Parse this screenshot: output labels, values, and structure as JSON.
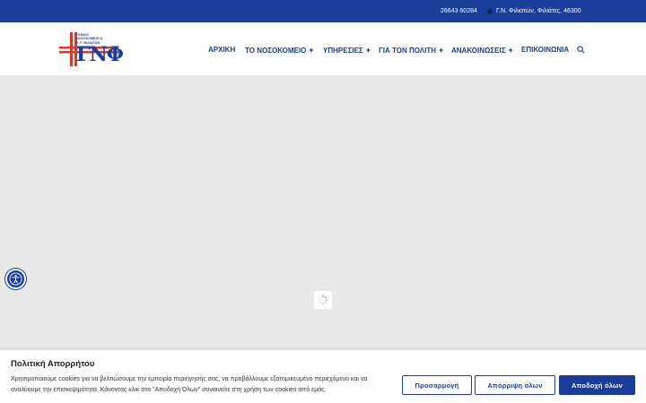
{
  "topbar": {
    "phone": "26643 60284",
    "address": "Γ.Ν. Φιλιατών, Φιλιάτες, 46300"
  },
  "logo": {
    "line1": "ΓΕΝΙΚΟ",
    "line2": "ΝΟΣΟΚΟΜΕΙΟ &",
    "line3": "Κ.Υ. ΦΙΛΙΑΤΩΝ",
    "letters": "ΓΝΦ"
  },
  "nav": {
    "items": [
      {
        "label": "ΑΡΧΙΚΗ",
        "has_submenu": false
      },
      {
        "label": "ΤΟ ΝΟΣΟΚΟΜΕΙΟ",
        "has_submenu": true
      },
      {
        "label": "ΥΠΗΡΕΣΙΕΣ",
        "has_submenu": true
      },
      {
        "label": "ΓΙΑ ΤΟΝ ΠΟΛΙΤΗ",
        "has_submenu": true
      },
      {
        "label": "ΑΝΑΚΟΙΝΩΣΕΙΣ",
        "has_submenu": true
      },
      {
        "label": "ΕΠΙΚΟΙΝΩΝΙΑ",
        "has_submenu": false
      }
    ],
    "plus": "+"
  },
  "cookie": {
    "title": "Πολιτική Απορρήτου",
    "text": "Χρησιμοποιούμε cookies για να βελτιώσουμε την εμπειρία περιήγησής σας, να προβάλλουμε εξατομικευμένο περιεχόμενο και να αναλύουμε την επισκεψιμότητα. Κάνοντας κλικ στο \"Αποδοχή Όλων\" συναινείτε στη χρήση των cookies από εμάς.",
    "customize_label": "Προσαρμογή",
    "reject_label": "Απόρριψη όλων",
    "accept_label": "Αποδοχή όλων"
  },
  "colors": {
    "brand": "#1a3d9a",
    "logo_red": "#d93a2b"
  }
}
